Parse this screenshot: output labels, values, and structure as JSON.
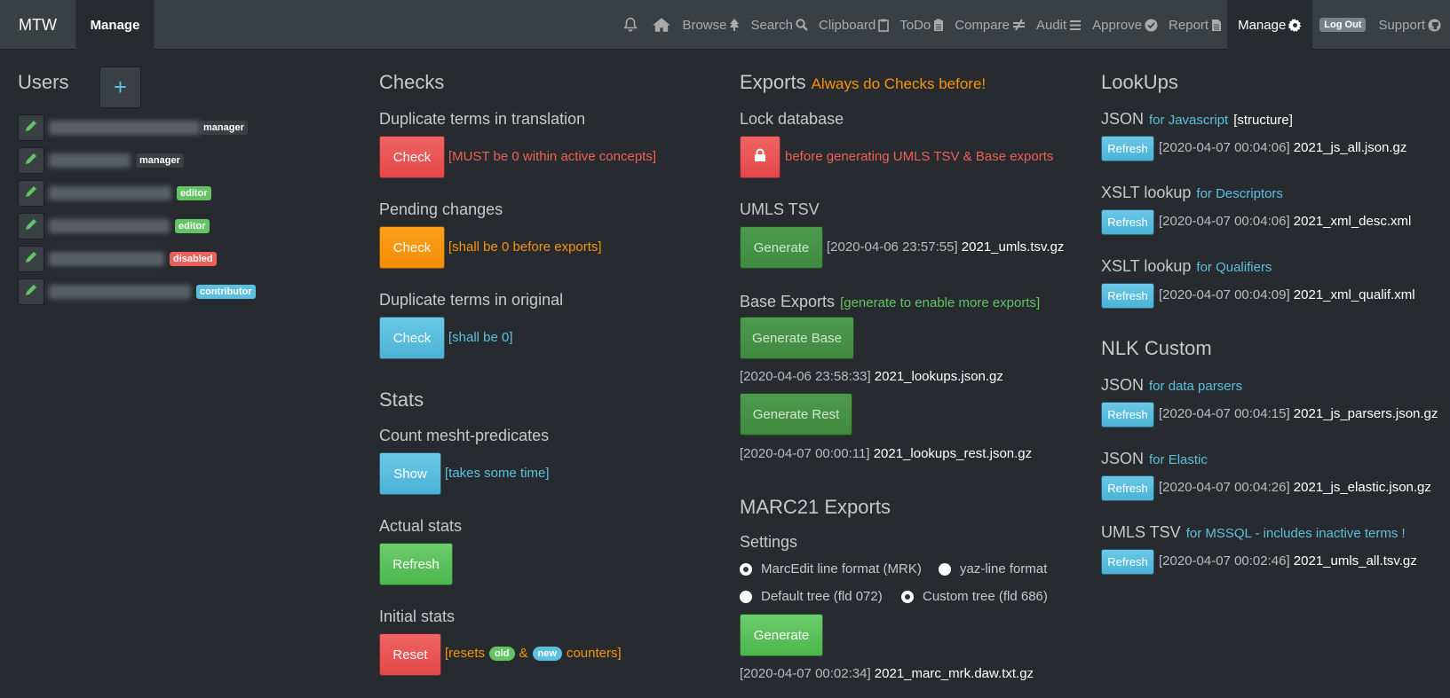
{
  "nav": {
    "brand": "MTW",
    "manage_left": "Manage",
    "items": [
      {
        "label": "",
        "icon": "bell-icon"
      },
      {
        "label": "",
        "icon": "home-icon"
      },
      {
        "label": "Browse",
        "icon": "tree-icon"
      },
      {
        "label": "Search",
        "icon": "search-icon"
      },
      {
        "label": "Clipboard",
        "icon": "clipboard-icon"
      },
      {
        "label": "ToDo",
        "icon": "clipboard-list-icon"
      },
      {
        "label": "Compare",
        "icon": "not-equal-icon"
      },
      {
        "label": "Audit",
        "icon": "bars-icon"
      },
      {
        "label": "Approve",
        "icon": "check-circle-icon"
      },
      {
        "label": "Report",
        "icon": "file-icon"
      },
      {
        "label": "Manage",
        "icon": "gear-icon"
      },
      {
        "label": "Support",
        "icon": "github-icon"
      }
    ],
    "logout": "Log Out"
  },
  "users": {
    "title": "Users",
    "add_label": "+",
    "rows": [
      {
        "badge": "manager",
        "badge_color": "dark"
      },
      {
        "badge": "manager",
        "badge_color": "dark"
      },
      {
        "badge": "editor",
        "badge_color": "green"
      },
      {
        "badge": "editor",
        "badge_color": "green"
      },
      {
        "badge": "disabled",
        "badge_color": "red"
      },
      {
        "badge": "contributor",
        "badge_color": "blue"
      }
    ]
  },
  "checks": {
    "title": "Checks",
    "dup_translation": {
      "heading": "Duplicate terms in translation",
      "button": "Check",
      "note": "[MUST be 0 within active concepts]"
    },
    "pending": {
      "heading": "Pending changes",
      "button": "Check",
      "note": "[shall be 0 before exports]"
    },
    "dup_original": {
      "heading": "Duplicate terms in original",
      "button": "Check",
      "note": "[shall be 0]"
    }
  },
  "stats": {
    "title": "Stats",
    "count": {
      "heading": "Count mesht-predicates",
      "button": "Show",
      "note": "[takes some time]"
    },
    "actual": {
      "heading": "Actual stats",
      "button": "Refresh"
    },
    "initial": {
      "heading": "Initial stats",
      "button": "Reset",
      "note_pre": "[resets",
      "pill_old": "old",
      "amp": "&",
      "pill_new": "new",
      "note_post": "counters]"
    }
  },
  "exports": {
    "title": "Exports",
    "warning": "Always do Checks before!",
    "lock": {
      "heading": "Lock database",
      "note": "before generating UMLS TSV & Base exports"
    },
    "umls": {
      "heading": "UMLS TSV",
      "button": "Generate",
      "timestamp": "[2020-04-06 23:57:55]",
      "file": "2021_umls.tsv.gz"
    },
    "base": {
      "heading": "Base Exports",
      "note": "[generate to enable more exports]",
      "button_base": "Generate Base",
      "ts_base": "[2020-04-06 23:58:33]",
      "file_base": "2021_lookups.json.gz",
      "button_rest": "Generate Rest",
      "ts_rest": "[2020-04-07 00:00:11]",
      "file_rest": "2021_lookups_rest.json.gz"
    },
    "marc": {
      "title": "MARC21 Exports",
      "settings": "Settings",
      "opt1": "MarcEdit line format (MRK)",
      "opt2": "yaz-line format",
      "opt3": "Default tree (fld 072)",
      "opt4": "Custom tree (fld 686)",
      "button": "Generate",
      "timestamp": "[2020-04-07 00:02:34]",
      "file": "2021_marc_mrk.daw.txt.gz"
    }
  },
  "lookups": {
    "title": "LookUps",
    "items": [
      {
        "heading": "JSON",
        "sub": "for Javascript",
        "extra": "[structure]",
        "button": "Refresh",
        "timestamp": "[2020-04-07 00:04:06]",
        "file": "2021_js_all.json.gz"
      },
      {
        "heading": "XSLT lookup",
        "sub": "for Descriptors",
        "button": "Refresh",
        "timestamp": "[2020-04-07 00:04:06]",
        "file": "2021_xml_desc.xml"
      },
      {
        "heading": "XSLT lookup",
        "sub": "for Qualifiers",
        "button": "Refresh",
        "timestamp": "[2020-04-07 00:04:09]",
        "file": "2021_xml_qualif.xml"
      }
    ],
    "nlk_title": "NLK Custom",
    "nlk_items": [
      {
        "heading": "JSON",
        "sub": "for data parsers",
        "button": "Refresh",
        "timestamp": "[2020-04-07 00:04:15]",
        "file": "2021_js_parsers.json.gz"
      },
      {
        "heading": "JSON",
        "sub": "for Elastic",
        "button": "Refresh",
        "timestamp": "[2020-04-07 00:04:26]",
        "file": "2021_js_elastic.json.gz"
      },
      {
        "heading": "UMLS TSV",
        "sub": "for MSSQL - includes inactive terms !",
        "button": "Refresh",
        "timestamp": "[2020-04-07 00:02:46]",
        "file": "2021_umls_all.tsv.gz"
      }
    ]
  }
}
